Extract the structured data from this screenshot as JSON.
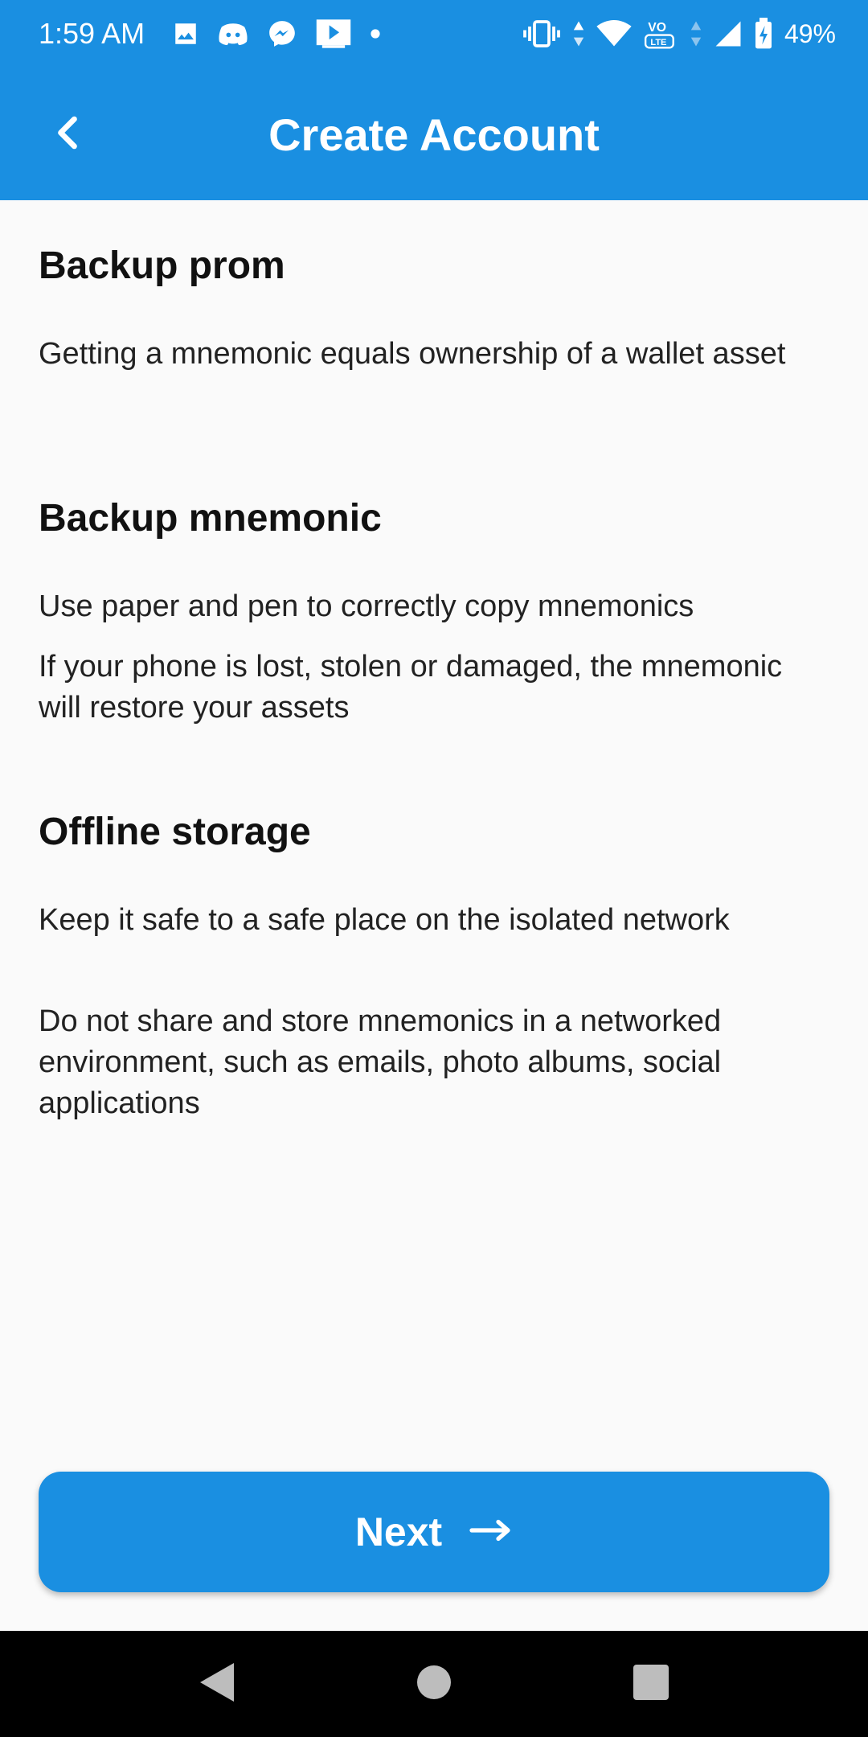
{
  "status_bar": {
    "time": "1:59 AM",
    "battery_percent": "49%",
    "left_icons": [
      "image-icon",
      "discord-icon",
      "messenger-icon",
      "media-icon",
      "dot-icon"
    ],
    "right_icons": [
      "vibrate-icon",
      "data-arrows-icon",
      "wifi-icon",
      "volte-icon",
      "signal-icon",
      "battery-icon"
    ]
  },
  "app_bar": {
    "title": "Create Account",
    "back_icon": "chevron-left-icon"
  },
  "sections": [
    {
      "title": "Backup prom",
      "paragraphs": [
        "Getting a mnemonic equals ownership of a wallet asset"
      ]
    },
    {
      "title": "Backup mnemonic",
      "paragraphs": [
        "Use paper and pen to correctly copy mnemonics",
        "If your phone is lost, stolen or damaged, the mnemonic will restore your assets"
      ]
    },
    {
      "title": "Offline storage",
      "paragraphs": [
        "Keep it safe to a safe place on the isolated network",
        "Do not share and store mnemonics in a networked environment, such as emails, photo albums, social applications"
      ]
    }
  ],
  "next_button": {
    "label": "Next",
    "icon": "arrow-right-icon"
  },
  "nav_bar": {
    "icons": [
      "nav-back-icon",
      "nav-home-icon",
      "nav-recents-icon"
    ]
  },
  "colors": {
    "primary": "#1a8fe1",
    "background": "#fafafa",
    "nav_bar": "#000000"
  }
}
